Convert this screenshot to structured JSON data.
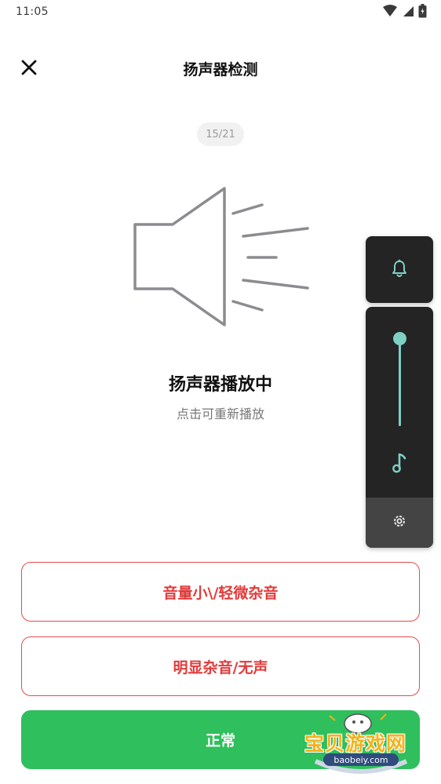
{
  "status_bar": {
    "time": "11:05",
    "icons": [
      "wifi-icon",
      "signal-icon",
      "battery-icon"
    ]
  },
  "header": {
    "title": "扬声器检测",
    "close_icon": "close-icon"
  },
  "progress": {
    "text": "15/21",
    "current": 15,
    "total": 21
  },
  "main": {
    "graphic_icon": "speaker-icon",
    "status_title": "扬声器播放中",
    "status_subtitle": "点击可重新播放"
  },
  "actions": {
    "low_volume_label": "音量小\\/轻微杂音",
    "obvious_noise_label": "明显杂音/无声",
    "normal_label": "正常"
  },
  "volume_panel": {
    "ringer_icon": "bell-icon",
    "music_icon": "music-note-icon",
    "settings_icon": "gear-icon",
    "level": 1.0,
    "accent": "#7ecfc4"
  },
  "watermark": {
    "text": "宝贝游戏网",
    "url": "baobeiy.com"
  },
  "colors": {
    "danger": "#e23b3b",
    "success": "#2fbf5c",
    "panel_bg": "#242424"
  }
}
